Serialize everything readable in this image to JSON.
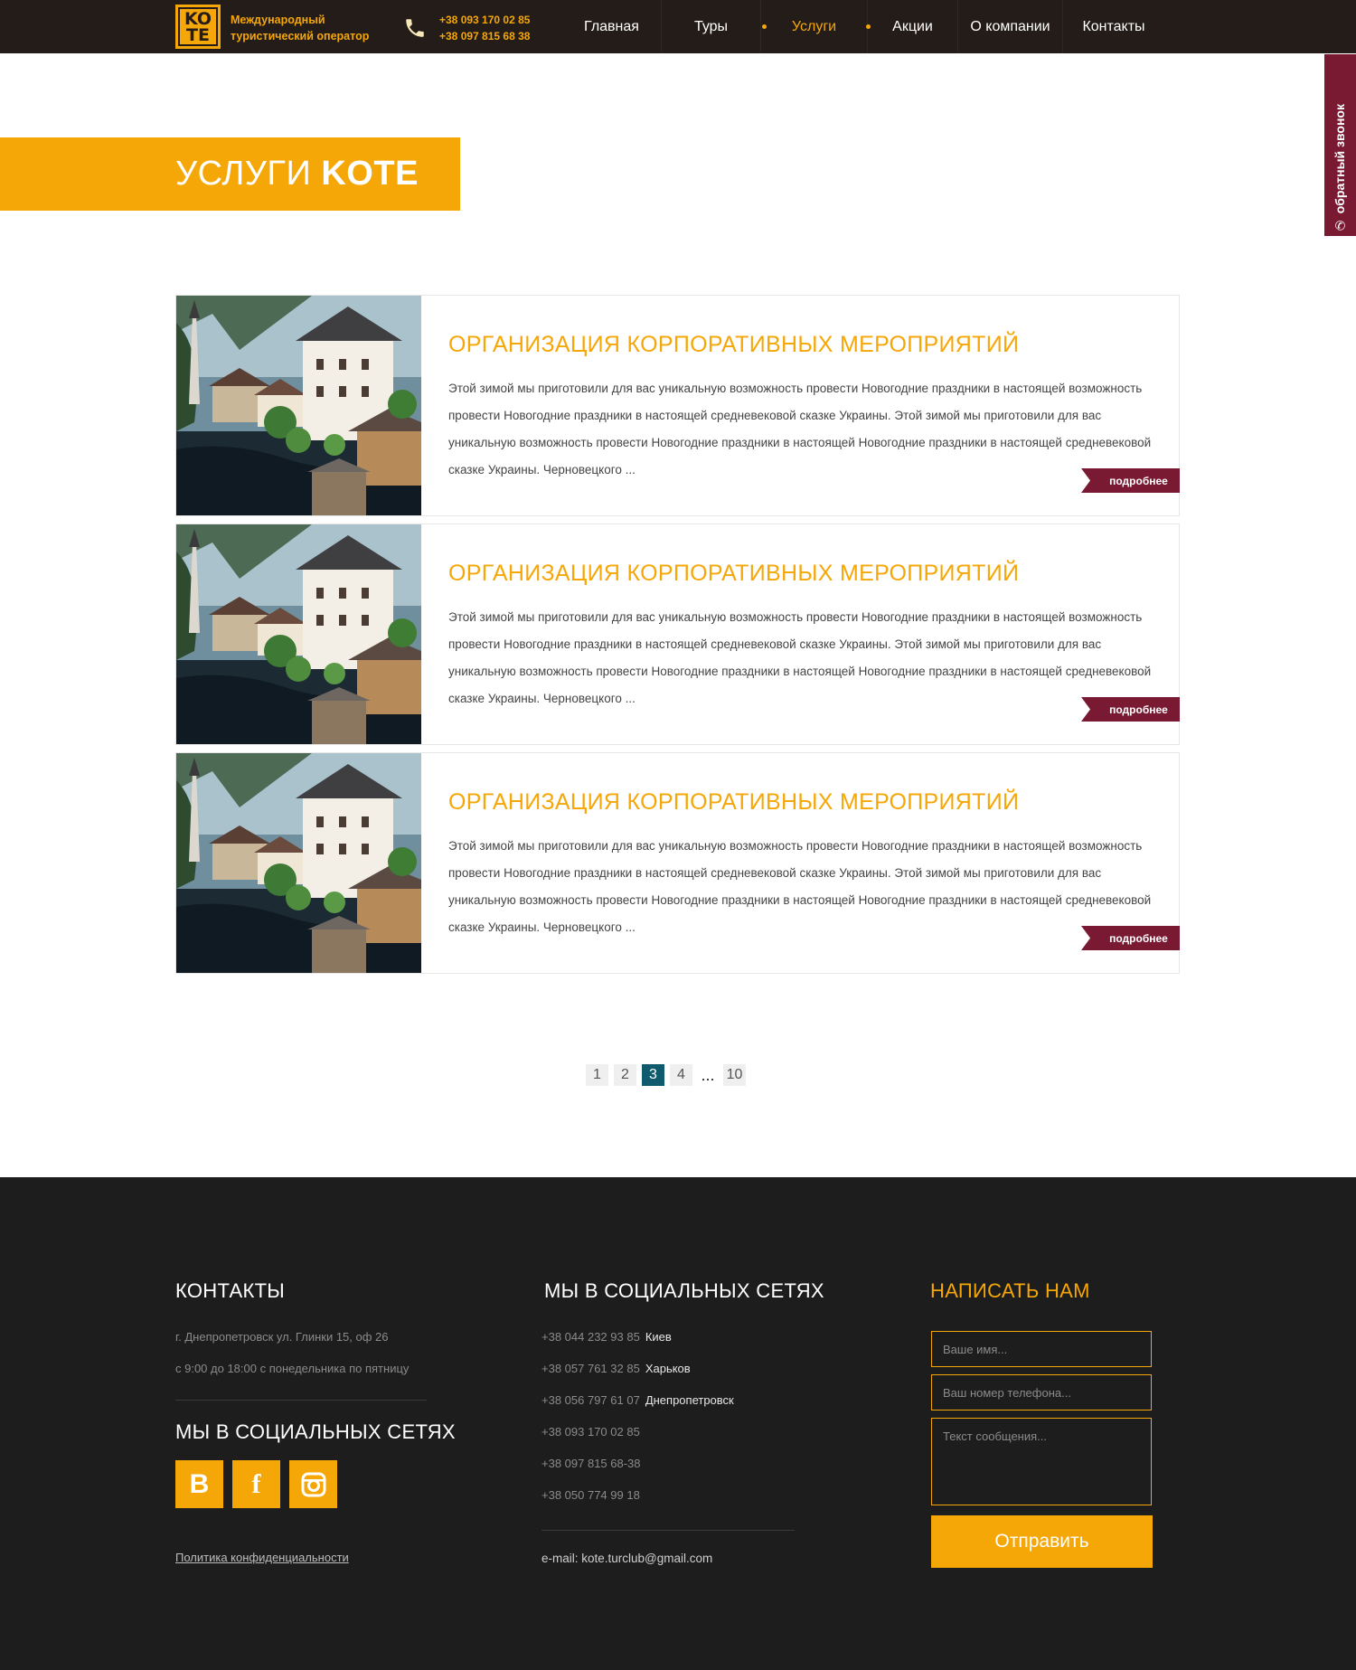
{
  "brand": {
    "logo_top": "KO",
    "logo_bottom": "TE",
    "tagline_line1": "Международный",
    "tagline_line2": "туристический оператор",
    "phone1": "+38 093 170 02 85",
    "phone2": "+38 097 815 68 38"
  },
  "nav": {
    "items": [
      "Главная",
      "Туры",
      "Услуги",
      "Акции",
      "О компании",
      "Контакты"
    ],
    "active": "Услуги"
  },
  "callback": {
    "label": "обратный звонок"
  },
  "page_title": {
    "light": "УСЛУГИ ",
    "bold": "KOTE"
  },
  "cards": [
    {
      "title": "ОРГАНИЗАЦИЯ КОРПОРАТИВНЫХ МЕРОПРИЯТИЙ",
      "text": "Этой зимой мы приготовили для вас уникальную возможность провести Новогодние праздники в настоящей возможность провести Новогодние праздники в настоящей средневековой сказке Украины. Этой зимой мы приготовили для вас уникальную возможность провести Новогодние праздники в настоящей Новогодние праздники в настоящей средневековой сказке Украины. Черновецкого  ...",
      "more": "подробнее"
    },
    {
      "title": "ОРГАНИЗАЦИЯ КОРПОРАТИВНЫХ МЕРОПРИЯТИЙ",
      "text": "Этой зимой мы приготовили для вас уникальную возможность провести Новогодние праздники в настоящей возможность провести Новогодние праздники в настоящей средневековой сказке Украины. Этой зимой мы приготовили для вас уникальную возможность провести Новогодние праздники в настоящей Новогодние праздники в настоящей средневековой сказке Украины. Черновецкого  ...",
      "more": "подробнее"
    },
    {
      "title": "ОРГАНИЗАЦИЯ КОРПОРАТИВНЫХ МЕРОПРИЯТИЙ",
      "text": "Этой зимой мы приготовили для вас уникальную возможность провести Новогодние праздники в настоящей возможность провести Новогодние праздники в настоящей средневековой сказке Украины. Этой зимой мы приготовили для вас уникальную возможность провести Новогодние праздники в настоящей Новогодние праздники в настоящей средневековой сказке Украины. Черновецкого  ...",
      "more": "подробнее"
    }
  ],
  "pagination": {
    "pages": [
      "1",
      "2",
      "3",
      "4"
    ],
    "current": "3",
    "ellipsis": "...",
    "last": "10"
  },
  "footer": {
    "contacts_heading": "КОНТАКТЫ",
    "address": "г. Днепропетровск ул. Глинки 15, оф 26",
    "hours": "с 9:00 до 18:00 с понедельника по пятницу",
    "social_heading_left": "МЫ В СОЦИАЛЬНЫХ СЕТЯХ",
    "social_icons": [
      "B",
      "f",
      "instagram-icon"
    ],
    "privacy": "Политика конфиденциальности",
    "social_heading_mid": "МЫ В СОЦИАЛЬНЫХ СЕТЯХ",
    "phones": [
      {
        "number": "+38 044 232 93 85",
        "city": "Киев"
      },
      {
        "number": "+38 057 761 32 85",
        "city": "Харьков"
      },
      {
        "number": "+38 056 797 61 07",
        "city": "Днепропетровск"
      },
      {
        "number": "+38 093 170 02 85",
        "city": ""
      },
      {
        "number": "+38 097 815 68-38",
        "city": ""
      },
      {
        "number": "+38 050 774 99 18",
        "city": ""
      }
    ],
    "email": "e-mail: kote.turclub@gmail.com",
    "write_heading": "НАПИСАТЬ НАМ",
    "form": {
      "name_placeholder": "Ваше имя...",
      "phone_placeholder": "Ваш номер телефона...",
      "message_placeholder": "Текст сообщения...",
      "submit": "Отправить"
    }
  },
  "colors": {
    "accent": "#f6a708",
    "header_bg": "#231c19",
    "more_btn": "#7a1a32",
    "page_current": "#0f5a6d",
    "footer_bg": "#1d1d1d"
  }
}
